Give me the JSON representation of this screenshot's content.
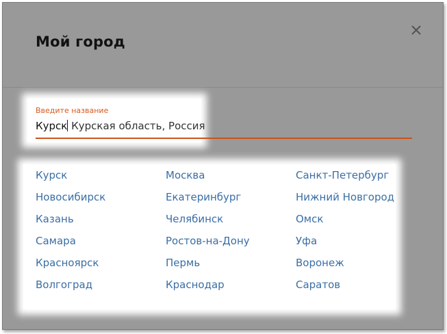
{
  "dialog": {
    "title": "Мой город",
    "close_icon": "close-icon"
  },
  "search": {
    "label": "Введите название",
    "typed": "Курск",
    "suggestion": " Курская область, Россия"
  },
  "cities": {
    "col1": [
      "Курск",
      "Новосибирск",
      "Казань",
      "Самара",
      "Красноярск",
      "Волгоград"
    ],
    "col2": [
      "Москва",
      "Екатеринбург",
      "Челябинск",
      "Ростов-на-Дону",
      "Пермь",
      "Краснодар"
    ],
    "col3": [
      "Санкт-Петербург",
      "Нижний Новгород",
      "Омск",
      "Уфа",
      "Воронеж",
      "Саратов"
    ]
  },
  "colors": {
    "accent": "#c9531a",
    "label": "#d95a1e",
    "link": "#3a6ea5",
    "title": "#1e1e1e"
  }
}
